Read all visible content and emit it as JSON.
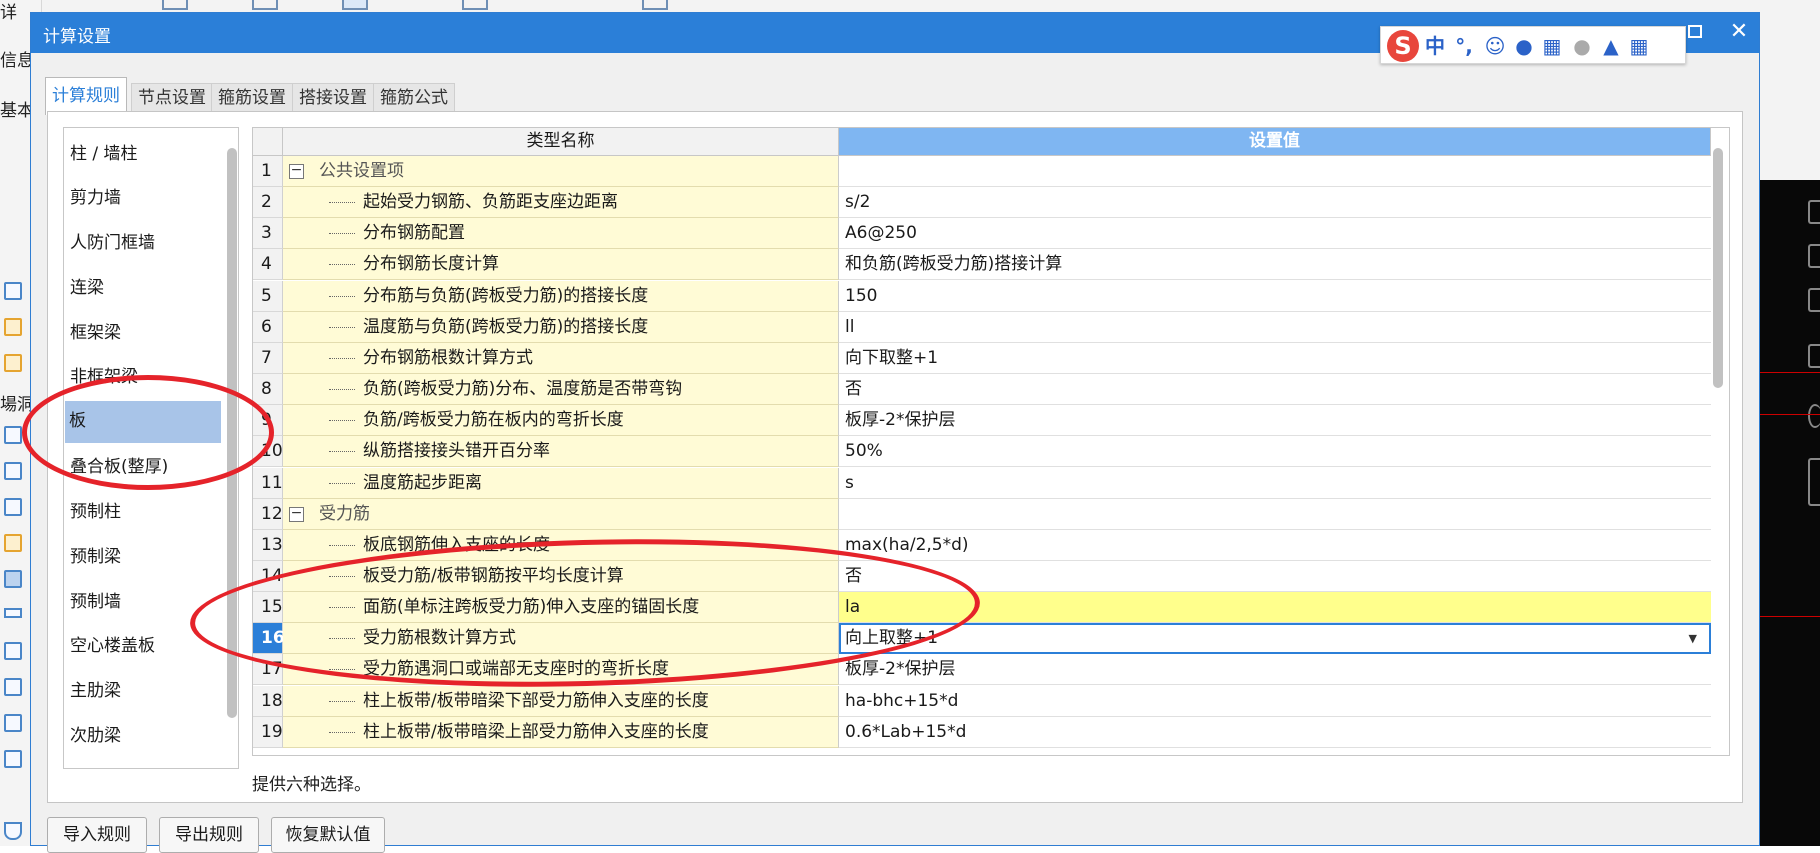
{
  "background": {
    "left_texts": [
      "详",
      "信息",
      "基本",
      "洞",
      "場洞"
    ],
    "icons": [
      "cube-icon",
      "beam-icon",
      "slab-icon",
      "column-icon",
      "grid-icon",
      "wall-icon",
      "filter-icon"
    ]
  },
  "dialog": {
    "title": "计算设置",
    "close_glyph": "✕"
  },
  "ime": {
    "logo": "S",
    "lang": "中",
    "punct": "°,",
    "icons": [
      "emoji-icon",
      "mic-icon",
      "keyboard-icon",
      "user-icon",
      "skin-icon",
      "grid-icon"
    ]
  },
  "tabs": [
    {
      "label": "计算规则",
      "active": true
    },
    {
      "label": "节点设置"
    },
    {
      "label": "箍筋设置"
    },
    {
      "label": "搭接设置"
    },
    {
      "label": "箍筋公式"
    }
  ],
  "categories": [
    "柱 / 墙柱",
    "剪力墙",
    "人防门框墙",
    "连梁",
    "框架梁",
    "非框架梁",
    "板",
    "叠合板(整厚)",
    "预制柱",
    "预制梁",
    "预制墙",
    "空心楼盖板",
    "主肋梁",
    "次肋梁"
  ],
  "selected_category": "板",
  "grid": {
    "headers": {
      "name": "类型名称",
      "value": "设置值"
    },
    "rows": [
      {
        "n": "1",
        "name": "公共设置项",
        "value": "",
        "group": true
      },
      {
        "n": "2",
        "name": "起始受力钢筋、负筋距支座边距离",
        "value": "s/2"
      },
      {
        "n": "3",
        "name": "分布钢筋配置",
        "value": "A6@250"
      },
      {
        "n": "4",
        "name": "分布钢筋长度计算",
        "value": "和负筋(跨板受力筋)搭接计算"
      },
      {
        "n": "5",
        "name": "分布筋与负筋(跨板受力筋)的搭接长度",
        "value": "150"
      },
      {
        "n": "6",
        "name": "温度筋与负筋(跨板受力筋)的搭接长度",
        "value": "ll"
      },
      {
        "n": "7",
        "name": "分布钢筋根数计算方式",
        "value": "向下取整+1"
      },
      {
        "n": "8",
        "name": "负筋(跨板受力筋)分布、温度筋是否带弯钩",
        "value": "否"
      },
      {
        "n": "9",
        "name": "负筋/跨板受力筋在板内的弯折长度",
        "value": "板厚-2*保护层"
      },
      {
        "n": "10",
        "name": "纵筋搭接接头错开百分率",
        "value": "50%"
      },
      {
        "n": "11",
        "name": "温度筋起步距离",
        "value": "s"
      },
      {
        "n": "12",
        "name": "受力筋",
        "value": "",
        "group": true
      },
      {
        "n": "13",
        "name": "板底钢筋伸入支座的长度",
        "value": "max(ha/2,5*d)"
      },
      {
        "n": "14",
        "name": "板受力筋/板带钢筋按平均长度计算",
        "value": "否"
      },
      {
        "n": "15",
        "name": "面筋(单标注跨板受力筋)伸入支座的锚固长度",
        "value": "la",
        "highlight": true
      },
      {
        "n": "16",
        "name": "受力筋根数计算方式",
        "value": "向上取整+1",
        "current": true
      },
      {
        "n": "17",
        "name": "受力筋遇洞口或端部无支座时的弯折长度",
        "value": "板厚-2*保护层"
      },
      {
        "n": "18",
        "name": "柱上板带/板带暗梁下部受力筋伸入支座的长度",
        "value": "ha-bhc+15*d"
      },
      {
        "n": "19",
        "name": "柱上板带/板带暗梁上部受力筋伸入支座的长度",
        "value": "0.6*Lab+15*d"
      }
    ]
  },
  "description": "提供六种选择。",
  "buttons": {
    "import": "导入规则",
    "export": "导出规则",
    "restore": "恢复默认值"
  },
  "colors": {
    "title_bar": "#2b7fd8",
    "selected_item": "#a8c4e8",
    "name_cell": "#fffbd6",
    "highlight_cell": "#ffff8c",
    "annotation": "#e5232a"
  }
}
